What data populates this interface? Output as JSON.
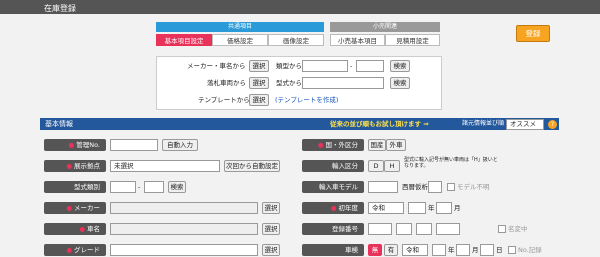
{
  "header": {
    "title": "在庫登録"
  },
  "tabs": {
    "group1": {
      "label": "共通項目",
      "items": [
        "基本項目設定",
        "価格設定",
        "画像設定"
      ]
    },
    "group2": {
      "label": "小売関連",
      "items": [
        "小売基本項目",
        "見積用設定"
      ]
    },
    "register_label": "登録"
  },
  "search": {
    "maker_label": "メーカー・車名から",
    "select_label": "選択",
    "type_label": "類型から",
    "type_sep": "-",
    "search_label": "検索",
    "auction_label": "落札車両から",
    "model_label": "型式から",
    "template_label": "テンプレートから",
    "template_create": "(テンプレートを作成)"
  },
  "basic": {
    "header": "基本情報",
    "order_text": "従来の並び順もお試し頂けます ⇒",
    "order_label": "諸元情報並び順",
    "order_value": "オススメ",
    "help_icon": "?",
    "mgmt_no": "管理No.",
    "auto_input": "自動入力",
    "display_loc": "展示拠点",
    "display_value": "未選択",
    "next_auto": "次回から自動設定",
    "model_type": "型式類別",
    "sep": "-",
    "search": "検索",
    "maker": "メーカー",
    "select": "選択",
    "car_name": "車名",
    "grade": "グレード",
    "country": "国・外区分",
    "domestic": "国産",
    "foreign": "外車",
    "import_type": "輸入区分",
    "d": "D",
    "h": "H",
    "import_note": "型式に輸入記号が無い車両は「H」扱いとなります。",
    "import_model": "輸入車モデル",
    "western": "西暦仮析",
    "model_unknown": "モデル不明",
    "first_reg": "初年度",
    "era": "令和",
    "year": "年",
    "month": "月",
    "reg_no": "登録番号",
    "name_change": "名変中",
    "inspection": "車検",
    "none": "無",
    "have": "有",
    "day": "日",
    "no_cert": "No.記録"
  }
}
